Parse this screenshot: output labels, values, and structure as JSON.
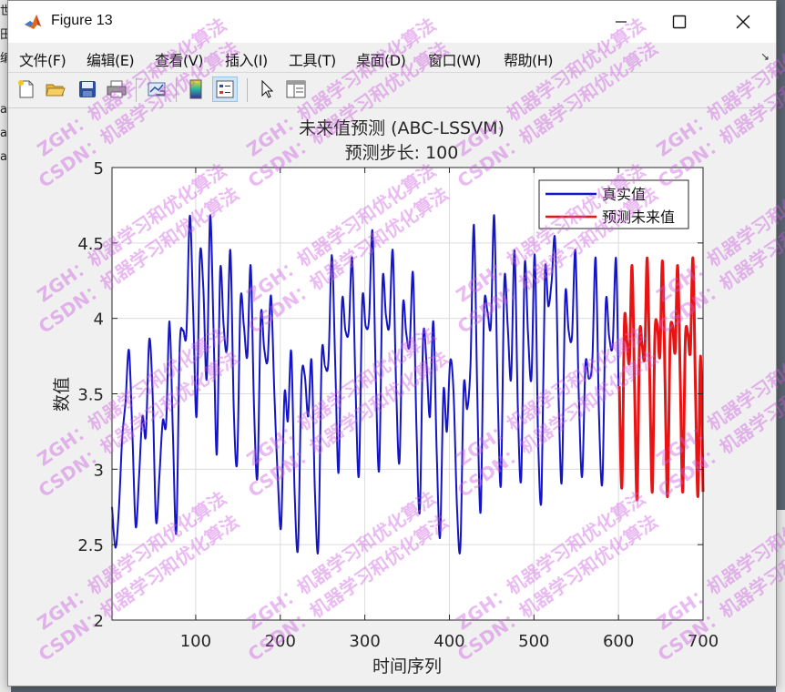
{
  "window": {
    "title": "Figure 13",
    "controls": {
      "minimize": "—",
      "maximize": "☐",
      "close": "✕"
    }
  },
  "menubar": {
    "items": [
      "文件(F)",
      "编辑(E)",
      "查看(V)",
      "插入(I)",
      "工具(T)",
      "桌面(D)",
      "窗口(W)",
      "帮助(H)"
    ],
    "dock_icon": "↘"
  },
  "toolbar": {
    "buttons": [
      "new-figure-icon",
      "open-file-icon",
      "save-icon",
      "print-icon",
      "link-plot-icon",
      "insert-colorbar-icon",
      "insert-legend-icon",
      "edit-plot-icon",
      "property-inspector-icon"
    ],
    "active": "insert-legend-icon"
  },
  "background_left_lines": [
    "世",
    "田",
    "编",
    "ai",
    "ai",
    "ai"
  ],
  "watermark": {
    "line1": "ZGH：机器学习和优化算法",
    "line2": "CSDN：机器学习和优化算法"
  },
  "chart_data": {
    "type": "line",
    "title": "未来值预测 (ABC-LSSVM)",
    "subtitle": "预测步长: 100",
    "xlabel": "时间序列",
    "ylabel": "数值",
    "xlim": [
      1,
      700
    ],
    "ylim": [
      2,
      5
    ],
    "xticks": [
      100,
      200,
      300,
      400,
      500,
      600,
      700
    ],
    "yticks": [
      2,
      2.5,
      3,
      3.5,
      4,
      4.5,
      5
    ],
    "grid": true,
    "legend_position": "top-right",
    "series": [
      {
        "name": "真实值",
        "color": "#1515c8",
        "x": [
          1,
          5,
          9,
          13,
          17,
          21,
          25,
          29,
          33,
          37,
          41,
          45,
          49,
          53,
          57,
          61,
          65,
          69,
          73,
          77,
          81,
          85,
          89,
          93,
          97,
          101,
          105,
          109,
          113,
          117,
          121,
          125,
          129,
          133,
          137,
          141,
          145,
          149,
          153,
          157,
          161,
          165,
          169,
          173,
          177,
          181,
          185,
          189,
          193,
          197,
          201,
          205,
          209,
          213,
          217,
          221,
          225,
          229,
          233,
          237,
          241,
          245,
          249,
          253,
          257,
          261,
          265,
          269,
          273,
          277,
          281,
          285,
          289,
          293,
          297,
          301,
          305,
          309,
          313,
          317,
          321,
          325,
          329,
          333,
          337,
          341,
          345,
          349,
          353,
          357,
          361,
          365,
          369,
          373,
          377,
          381,
          385,
          389,
          393,
          397,
          401,
          405,
          409,
          413,
          417,
          421,
          425,
          429,
          433,
          437,
          441,
          445,
          449,
          453,
          457,
          461,
          465,
          469,
          473,
          477,
          481,
          485,
          489,
          493,
          497,
          501,
          505,
          509,
          513,
          517,
          521,
          525,
          529,
          533,
          537,
          541,
          545,
          549,
          553,
          557,
          561,
          565,
          569,
          573,
          577,
          581,
          585,
          589,
          593,
          597,
          600
        ],
        "y": [
          2.75,
          2.48,
          2.72,
          3.2,
          3.45,
          3.79,
          3.25,
          2.62,
          2.95,
          3.35,
          3.22,
          3.86,
          3.5,
          2.66,
          2.95,
          3.32,
          3.3,
          3.98,
          3.25,
          2.58,
          3.8,
          3.92,
          3.9,
          4.68,
          4.05,
          3.35,
          4.42,
          4.2,
          3.6,
          4.68,
          3.95,
          3.1,
          4.32,
          3.95,
          3.8,
          4.45,
          3.4,
          3.05,
          4.12,
          3.95,
          3.75,
          4.35,
          3.4,
          2.95,
          4.02,
          3.8,
          3.72,
          4.15,
          3.5,
          2.95,
          2.62,
          3.5,
          3.32,
          3.78,
          2.85,
          2.48,
          3.58,
          3.62,
          3.35,
          3.72,
          2.85,
          2.48,
          3.75,
          3.68,
          3.72,
          4.42,
          3.7,
          2.98,
          4.1,
          3.92,
          3.92,
          4.4,
          3.55,
          2.96,
          4.12,
          3.95,
          4.0,
          4.58,
          3.6,
          3.0,
          4.25,
          4.02,
          3.95,
          4.45,
          3.55,
          3.05,
          4.08,
          3.9,
          3.82,
          4.3,
          3.3,
          2.72,
          3.88,
          3.7,
          3.35,
          3.98,
          3.12,
          2.55,
          3.52,
          3.25,
          3.72,
          3.5,
          2.75,
          2.48,
          3.55,
          3.4,
          3.7,
          4.62,
          3.5,
          2.72,
          4.05,
          4.05,
          3.95,
          4.68,
          3.55,
          2.9,
          4.25,
          3.95,
          3.6,
          4.45,
          3.4,
          2.95,
          4.35,
          3.9,
          3.6,
          4.42,
          3.2,
          2.82,
          4.3,
          4.08,
          4.25,
          4.52,
          3.52,
          2.92,
          4.15,
          3.92,
          3.88,
          4.45,
          3.5,
          2.95,
          3.7,
          3.6,
          3.72,
          4.4,
          3.35,
          2.92,
          4.1,
          3.88,
          3.82,
          4.4,
          3.55
        ],
        "show_in_legend": true
      },
      {
        "name": "预测未来值",
        "color": "#e81414",
        "x": [
          601,
          604,
          607,
          610,
          613,
          616,
          619,
          622,
          625,
          628,
          631,
          634,
          637,
          640,
          643,
          646,
          649,
          652,
          655,
          658,
          661,
          664,
          667,
          670,
          673,
          676,
          679,
          682,
          685,
          688,
          691,
          694,
          697,
          700
        ],
        "y": [
          3.55,
          2.88,
          3.98,
          3.85,
          3.72,
          4.35,
          3.55,
          2.8,
          3.88,
          3.82,
          3.75,
          4.4,
          3.6,
          2.85,
          3.88,
          3.95,
          3.75,
          4.38,
          3.6,
          2.82,
          3.85,
          3.95,
          3.78,
          4.35,
          3.62,
          2.85,
          3.85,
          3.9,
          3.78,
          4.4,
          3.55,
          2.82,
          3.75,
          2.85
        ],
        "show_in_legend": true
      }
    ]
  }
}
